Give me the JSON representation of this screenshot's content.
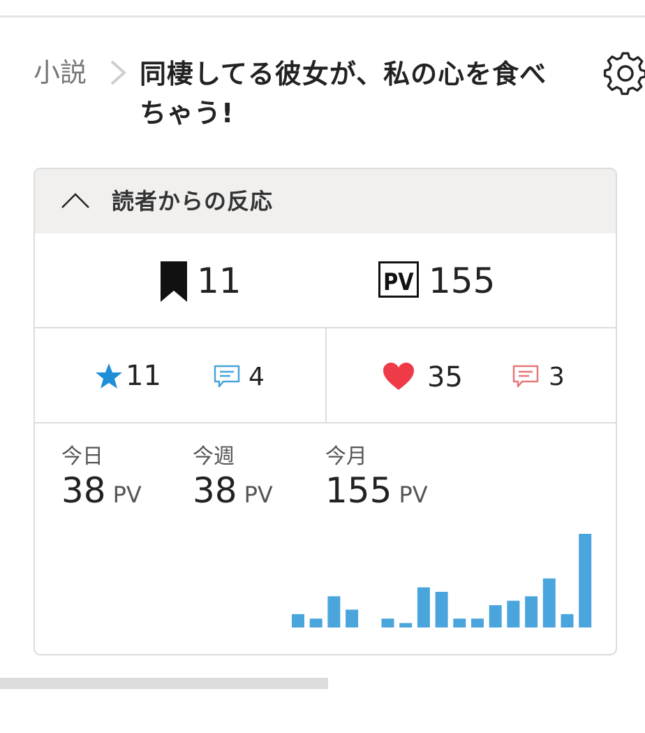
{
  "breadcrumb": {
    "label": "小説"
  },
  "work": {
    "title": "同棲してる彼女が、私の心を食べちゃう!"
  },
  "icons": {
    "settings": "gear-icon",
    "separator": "chevron-right-icon",
    "collapse": "chevron-up-icon",
    "bookmark": "bookmark-icon",
    "pv": "pv-icon",
    "star": "star-icon",
    "comment": "comment-icon",
    "heart": "heart-icon"
  },
  "colors": {
    "star": "#1e8fd6",
    "comment_blue": "#48a3d8",
    "heart": "#ef3a47",
    "comment_red": "#e6787b",
    "bar": "#4ba5dd"
  },
  "reactions": {
    "section_title": "読者からの反応",
    "bookmarks": "11",
    "pv_total": "155",
    "stars": "11",
    "star_comments": "4",
    "hearts": "35",
    "heart_comments": "3"
  },
  "pv_stats": {
    "today": {
      "label": "今日",
      "value": "38",
      "unit": "PV"
    },
    "week": {
      "label": "今週",
      "value": "38",
      "unit": "PV"
    },
    "month": {
      "label": "今月",
      "value": "155",
      "unit": "PV"
    }
  },
  "chart_data": {
    "type": "bar",
    "values": [
      3,
      2,
      7,
      4,
      0,
      2,
      1,
      9,
      8,
      2,
      2,
      5,
      6,
      7,
      11,
      3,
      21
    ]
  }
}
